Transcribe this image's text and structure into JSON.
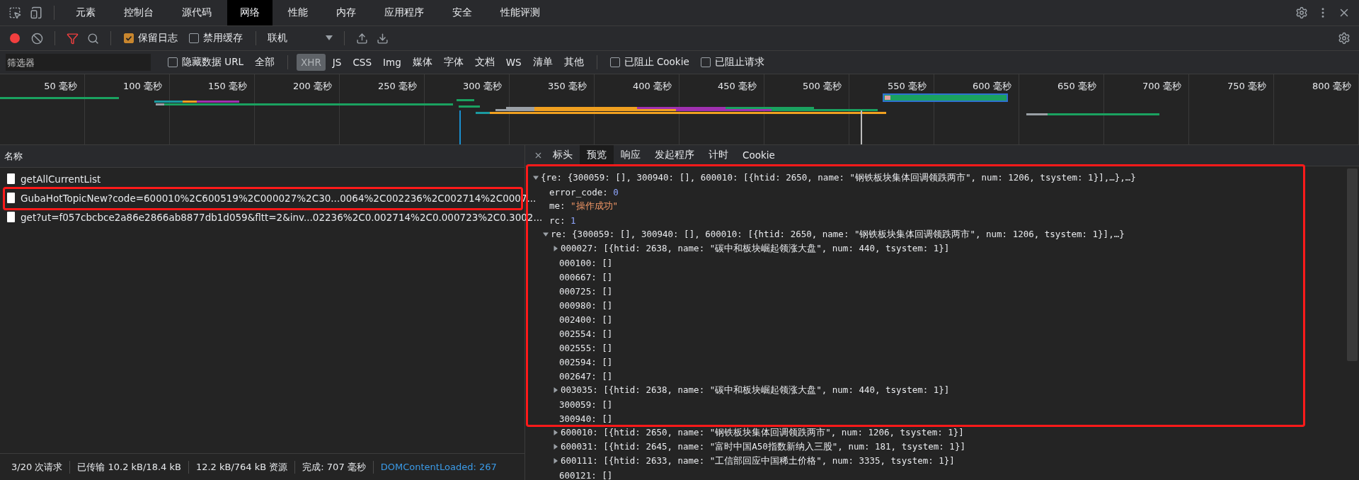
{
  "top_tabs": [
    {
      "label": "元素",
      "selected": false
    },
    {
      "label": "控制台",
      "selected": false
    },
    {
      "label": "源代码",
      "selected": false
    },
    {
      "label": "网络",
      "selected": true
    },
    {
      "label": "性能",
      "selected": false
    },
    {
      "label": "内存",
      "selected": false
    },
    {
      "label": "应用程序",
      "selected": false
    },
    {
      "label": "安全",
      "selected": false
    },
    {
      "label": "性能评测",
      "selected": false
    }
  ],
  "toolbar": {
    "preserve_log": {
      "label": "保留日志",
      "checked": true
    },
    "disable_cache": {
      "label": "禁用缓存",
      "checked": false
    },
    "throttling": {
      "value": "联机"
    }
  },
  "filter_bar": {
    "placeholder": "筛选器",
    "hide_data_urls": {
      "label": "隐藏数据 URL",
      "checked": false
    },
    "types": [
      {
        "label": "全部",
        "selected": false
      },
      {
        "label": "XHR",
        "selected": true
      },
      {
        "label": "JS",
        "selected": false
      },
      {
        "label": "CSS",
        "selected": false
      },
      {
        "label": "Img",
        "selected": false
      },
      {
        "label": "媒体",
        "selected": false
      },
      {
        "label": "字体",
        "selected": false
      },
      {
        "label": "文档",
        "selected": false
      },
      {
        "label": "WS",
        "selected": false
      },
      {
        "label": "清单",
        "selected": false
      },
      {
        "label": "其他",
        "selected": false
      }
    ],
    "blocked_cookies": {
      "label": "已阻止 Cookie",
      "checked": false
    },
    "blocked_requests": {
      "label": "已阻止请求",
      "checked": false
    }
  },
  "timeline": {
    "ticks": [
      "50 毫秒",
      "100 毫秒",
      "150 毫秒",
      "200 毫秒",
      "250 毫秒",
      "300 毫秒",
      "350 毫秒",
      "400 毫秒",
      "450 毫秒",
      "500 毫秒",
      "550 毫秒",
      "600 毫秒",
      "650 毫秒",
      "700 毫秒",
      "750 毫秒",
      "800 毫秒"
    ]
  },
  "requests": {
    "column": "名称",
    "rows": [
      {
        "name": "getAllCurrentList"
      },
      {
        "name": "GubaHotTopicNew?code=600010%2C600519%2C000027%2C30...0064%2C002236%2C002714%2C0007..."
      },
      {
        "name": "get?ut=f057cbcbce2a86e2866ab8877db1d059&fltt=2&inv...02236%2C0.002714%2C0.000723%2C0.3002..."
      }
    ]
  },
  "status_bar": [
    {
      "text": "3/20 次请求",
      "kind": "stat"
    },
    {
      "text": "已传输 10.2 kB/18.4 kB",
      "kind": "stat"
    },
    {
      "text": "12.2 kB/764 kB 资源",
      "kind": "stat"
    },
    {
      "text": "完成: 707 毫秒",
      "kind": "stat"
    },
    {
      "text": "DOMContentLoaded: 267",
      "kind": "event"
    }
  ],
  "detail_tabs": [
    {
      "label": "标头",
      "selected": false
    },
    {
      "label": "预览",
      "selected": true
    },
    {
      "label": "响应",
      "selected": false
    },
    {
      "label": "发起程序",
      "selected": false
    },
    {
      "label": "计时",
      "selected": false
    },
    {
      "label": "Cookie",
      "selected": false
    }
  ],
  "preview": {
    "value": "{re: {300059: [], 300940: [], 600010: [{htid: 2650, name: \"钢铁板块集体回调领跌两市\", num: 1206, tsystem: 1}],…},…}",
    "kind": "plain",
    "expanded": true,
    "children": [
      {
        "key": "error_code:",
        "value": "0",
        "kind": "number"
      },
      {
        "key": "me:",
        "value": "\"操作成功\"",
        "kind": "string"
      },
      {
        "key": "rc:",
        "value": "1",
        "kind": "number"
      },
      {
        "key": "re:",
        "value": "{300059: [], 300940: [], 600010: [{htid: 2650, name: \"钢铁板块集体回调领跌两市\", num: 1206, tsystem: 1}],…}",
        "kind": "plain",
        "expanded": true,
        "children": [
          {
            "key": "000027:",
            "value": "[{htid: 2638, name: \"碳中和板块崛起领涨大盘\", num: 440, tsystem: 1}]",
            "kind": "plain",
            "expanded": false
          },
          {
            "key": "000100:",
            "value": "[]",
            "kind": "plain"
          },
          {
            "key": "000667:",
            "value": "[]",
            "kind": "plain"
          },
          {
            "key": "000725:",
            "value": "[]",
            "kind": "plain"
          },
          {
            "key": "000980:",
            "value": "[]",
            "kind": "plain"
          },
          {
            "key": "002400:",
            "value": "[]",
            "kind": "plain"
          },
          {
            "key": "002554:",
            "value": "[]",
            "kind": "plain"
          },
          {
            "key": "002555:",
            "value": "[]",
            "kind": "plain"
          },
          {
            "key": "002594:",
            "value": "[]",
            "kind": "plain"
          },
          {
            "key": "002647:",
            "value": "[]",
            "kind": "plain"
          },
          {
            "key": "003035:",
            "value": "[{htid: 2638, name: \"碳中和板块崛起领涨大盘\", num: 440, tsystem: 1}]",
            "kind": "plain",
            "expanded": false
          },
          {
            "key": "300059:",
            "value": "[]",
            "kind": "plain"
          },
          {
            "key": "300940:",
            "value": "[]",
            "kind": "plain"
          },
          {
            "key": "600010:",
            "value": "[{htid: 2650, name: \"钢铁板块集体回调领跌两市\", num: 1206, tsystem: 1}]",
            "kind": "plain",
            "expanded": false
          },
          {
            "key": "600031:",
            "value": "[{htid: 2645, name: \"富时中国A50指数新纳入三股\", num: 181, tsystem: 1}]",
            "kind": "plain",
            "expanded": false
          },
          {
            "key": "600111:",
            "value": "[{htid: 2633, name: \"工信部回应中国稀土价格\", num: 3335, tsystem: 1}]",
            "kind": "plain",
            "expanded": false
          },
          {
            "key": "600121:",
            "value": "[]",
            "kind": "plain"
          }
        ]
      }
    ]
  }
}
